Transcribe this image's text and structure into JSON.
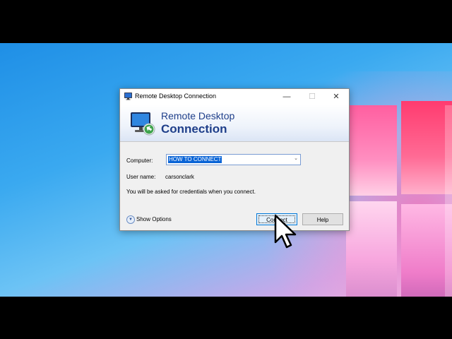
{
  "window": {
    "title": "Remote Desktop Connection",
    "controls": {
      "minimize": "—",
      "maximize": "☐",
      "close": "✕"
    }
  },
  "banner": {
    "line1": "Remote Desktop",
    "line2": "Connection"
  },
  "form": {
    "computer_label": "Computer:",
    "computer_value": "HOW TO CONNECT",
    "username_label": "User name:",
    "username_value": "carsonclark",
    "note": "You will be asked for credentials when you connect."
  },
  "footer": {
    "show_options": "Show Options",
    "connect": "Connect",
    "help": "Help"
  },
  "colors": {
    "banner_text": "#1f3f8a",
    "selection": "#0a64d6",
    "focus_border": "#0078d7"
  }
}
